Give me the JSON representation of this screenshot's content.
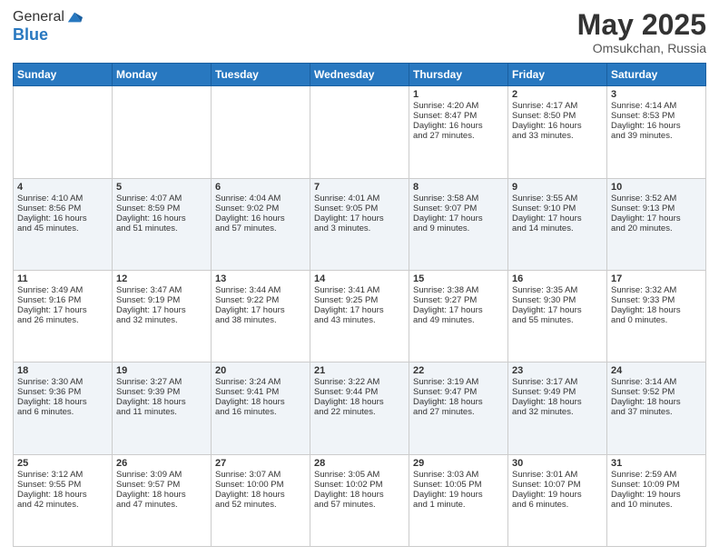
{
  "header": {
    "logo_general": "General",
    "logo_blue": "Blue",
    "title": "May 2025",
    "location": "Omsukchan, Russia"
  },
  "weekdays": [
    "Sunday",
    "Monday",
    "Tuesday",
    "Wednesday",
    "Thursday",
    "Friday",
    "Saturday"
  ],
  "rows": [
    [
      {
        "day": "",
        "info": ""
      },
      {
        "day": "",
        "info": ""
      },
      {
        "day": "",
        "info": ""
      },
      {
        "day": "",
        "info": ""
      },
      {
        "day": "1",
        "info": "Sunrise: 4:20 AM\nSunset: 8:47 PM\nDaylight: 16 hours\nand 27 minutes."
      },
      {
        "day": "2",
        "info": "Sunrise: 4:17 AM\nSunset: 8:50 PM\nDaylight: 16 hours\nand 33 minutes."
      },
      {
        "day": "3",
        "info": "Sunrise: 4:14 AM\nSunset: 8:53 PM\nDaylight: 16 hours\nand 39 minutes."
      }
    ],
    [
      {
        "day": "4",
        "info": "Sunrise: 4:10 AM\nSunset: 8:56 PM\nDaylight: 16 hours\nand 45 minutes."
      },
      {
        "day": "5",
        "info": "Sunrise: 4:07 AM\nSunset: 8:59 PM\nDaylight: 16 hours\nand 51 minutes."
      },
      {
        "day": "6",
        "info": "Sunrise: 4:04 AM\nSunset: 9:02 PM\nDaylight: 16 hours\nand 57 minutes."
      },
      {
        "day": "7",
        "info": "Sunrise: 4:01 AM\nSunset: 9:05 PM\nDaylight: 17 hours\nand 3 minutes."
      },
      {
        "day": "8",
        "info": "Sunrise: 3:58 AM\nSunset: 9:07 PM\nDaylight: 17 hours\nand 9 minutes."
      },
      {
        "day": "9",
        "info": "Sunrise: 3:55 AM\nSunset: 9:10 PM\nDaylight: 17 hours\nand 14 minutes."
      },
      {
        "day": "10",
        "info": "Sunrise: 3:52 AM\nSunset: 9:13 PM\nDaylight: 17 hours\nand 20 minutes."
      }
    ],
    [
      {
        "day": "11",
        "info": "Sunrise: 3:49 AM\nSunset: 9:16 PM\nDaylight: 17 hours\nand 26 minutes."
      },
      {
        "day": "12",
        "info": "Sunrise: 3:47 AM\nSunset: 9:19 PM\nDaylight: 17 hours\nand 32 minutes."
      },
      {
        "day": "13",
        "info": "Sunrise: 3:44 AM\nSunset: 9:22 PM\nDaylight: 17 hours\nand 38 minutes."
      },
      {
        "day": "14",
        "info": "Sunrise: 3:41 AM\nSunset: 9:25 PM\nDaylight: 17 hours\nand 43 minutes."
      },
      {
        "day": "15",
        "info": "Sunrise: 3:38 AM\nSunset: 9:27 PM\nDaylight: 17 hours\nand 49 minutes."
      },
      {
        "day": "16",
        "info": "Sunrise: 3:35 AM\nSunset: 9:30 PM\nDaylight: 17 hours\nand 55 minutes."
      },
      {
        "day": "17",
        "info": "Sunrise: 3:32 AM\nSunset: 9:33 PM\nDaylight: 18 hours\nand 0 minutes."
      }
    ],
    [
      {
        "day": "18",
        "info": "Sunrise: 3:30 AM\nSunset: 9:36 PM\nDaylight: 18 hours\nand 6 minutes."
      },
      {
        "day": "19",
        "info": "Sunrise: 3:27 AM\nSunset: 9:39 PM\nDaylight: 18 hours\nand 11 minutes."
      },
      {
        "day": "20",
        "info": "Sunrise: 3:24 AM\nSunset: 9:41 PM\nDaylight: 18 hours\nand 16 minutes."
      },
      {
        "day": "21",
        "info": "Sunrise: 3:22 AM\nSunset: 9:44 PM\nDaylight: 18 hours\nand 22 minutes."
      },
      {
        "day": "22",
        "info": "Sunrise: 3:19 AM\nSunset: 9:47 PM\nDaylight: 18 hours\nand 27 minutes."
      },
      {
        "day": "23",
        "info": "Sunrise: 3:17 AM\nSunset: 9:49 PM\nDaylight: 18 hours\nand 32 minutes."
      },
      {
        "day": "24",
        "info": "Sunrise: 3:14 AM\nSunset: 9:52 PM\nDaylight: 18 hours\nand 37 minutes."
      }
    ],
    [
      {
        "day": "25",
        "info": "Sunrise: 3:12 AM\nSunset: 9:55 PM\nDaylight: 18 hours\nand 42 minutes."
      },
      {
        "day": "26",
        "info": "Sunrise: 3:09 AM\nSunset: 9:57 PM\nDaylight: 18 hours\nand 47 minutes."
      },
      {
        "day": "27",
        "info": "Sunrise: 3:07 AM\nSunset: 10:00 PM\nDaylight: 18 hours\nand 52 minutes."
      },
      {
        "day": "28",
        "info": "Sunrise: 3:05 AM\nSunset: 10:02 PM\nDaylight: 18 hours\nand 57 minutes."
      },
      {
        "day": "29",
        "info": "Sunrise: 3:03 AM\nSunset: 10:05 PM\nDaylight: 19 hours\nand 1 minute."
      },
      {
        "day": "30",
        "info": "Sunrise: 3:01 AM\nSunset: 10:07 PM\nDaylight: 19 hours\nand 6 minutes."
      },
      {
        "day": "31",
        "info": "Sunrise: 2:59 AM\nSunset: 10:09 PM\nDaylight: 19 hours\nand 10 minutes."
      }
    ]
  ]
}
